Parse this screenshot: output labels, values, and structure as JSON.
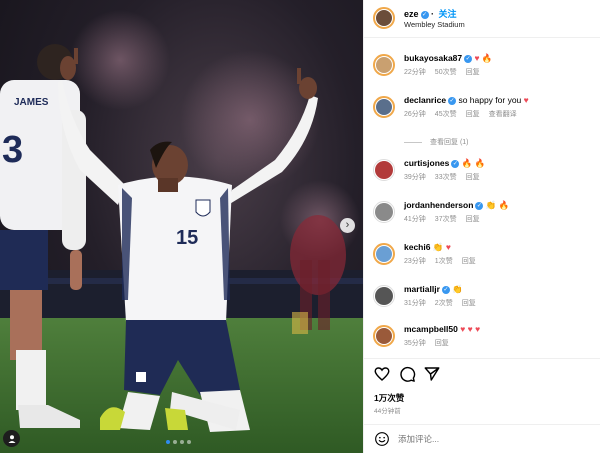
{
  "post": {
    "username": "eze",
    "follow_label": "关注",
    "location": "Wembley Stadium",
    "likes": "1万次赞",
    "time": "44分钟前",
    "add_comment_placeholder": "添加评论..."
  },
  "photo": {
    "shirt_text_left": "JAMES",
    "shirt_number_left": "3",
    "shirt_number_center": "15"
  },
  "comments": [
    {
      "user": "bukayosaka87",
      "verified": true,
      "text": "",
      "emoji": [
        "heart-red",
        "flame"
      ],
      "time": "22分钟",
      "likes": "50次赞",
      "reply": "回复",
      "translate": "",
      "avatar_color": "#c9a070"
    },
    {
      "user": "declanrice",
      "verified": true,
      "text": "so happy for you",
      "emoji": [
        "heart-red"
      ],
      "time": "26分钟",
      "likes": "45次赞",
      "reply": "回复",
      "translate": "查看翻译",
      "avatar_color": "#5a6f8c"
    },
    {
      "user": "curtisjones",
      "verified": true,
      "text": "",
      "emoji": [
        "flame",
        "flame"
      ],
      "time": "39分钟",
      "likes": "33次赞",
      "reply": "回复",
      "translate": "",
      "avatar_color": "#b23a3a"
    },
    {
      "user": "jordanhenderson",
      "verified": true,
      "text": "",
      "emoji": [
        "clap",
        "flame"
      ],
      "time": "41分钟",
      "likes": "37次赞",
      "reply": "回复",
      "translate": "",
      "avatar_color": "#8a8a8a"
    },
    {
      "user": "kechi6",
      "verified": false,
      "text": "",
      "emoji": [
        "clap",
        "heart-red"
      ],
      "time": "23分钟",
      "likes": "1次赞",
      "reply": "回复",
      "translate": "",
      "avatar_color": "#6a9fd4"
    },
    {
      "user": "martialljr",
      "verified": true,
      "text": "",
      "emoji": [
        "clap"
      ],
      "time": "31分钟",
      "likes": "2次赞",
      "reply": "回复",
      "translate": "",
      "avatar_color": "#555555"
    },
    {
      "user": "mcampbell50",
      "verified": false,
      "text": "",
      "emoji": [
        "heart-red",
        "heart-red",
        "heart-red"
      ],
      "time": "35分钟",
      "likes": "",
      "reply": "回复",
      "translate": "",
      "avatar_color": "#9a5a3a"
    }
  ],
  "view_replies_label": "查看回复 (1)",
  "icons": {
    "verified": "verified-badge-icon",
    "heart": "heart-outline-icon",
    "comment": "comment-bubble-icon",
    "share": "paper-plane-icon",
    "bookmark": "bookmark-icon",
    "emoji": "smiley-icon",
    "next": "chevron-right-icon",
    "tag": "person-tag-icon"
  },
  "colors": {
    "link": "#0095f6",
    "verified": "#3897f0",
    "story_ring": "#f0a84a",
    "heart": "#ed4956"
  }
}
